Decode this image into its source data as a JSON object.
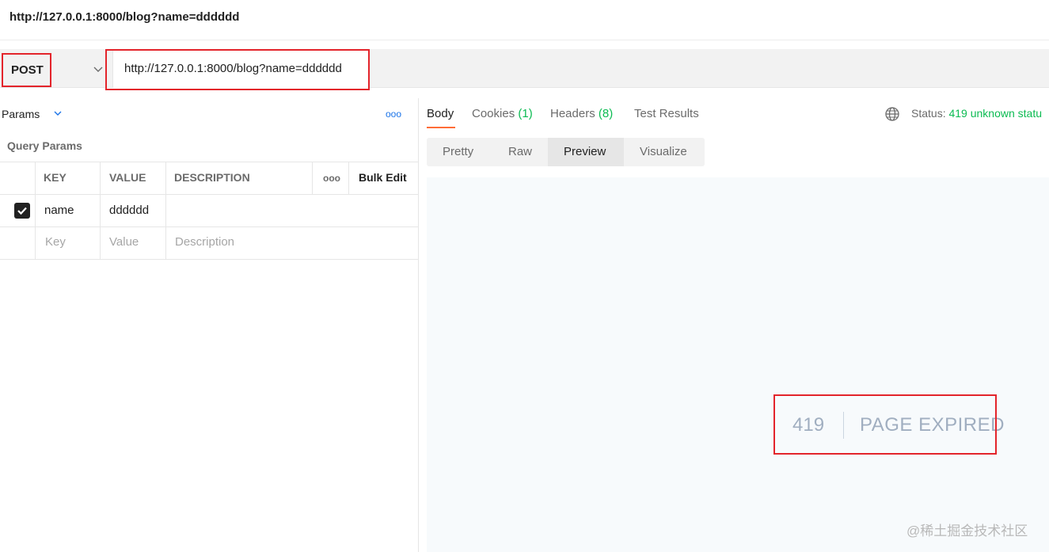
{
  "window": {
    "title": "http://127.0.0.1:8000/blog?name=dddddd"
  },
  "request": {
    "method": "POST",
    "url": "http://127.0.0.1:8000/blog?name=dddddd"
  },
  "params_panel": {
    "tab_label": "Params",
    "section_title": "Query Params",
    "more_icon": "ooo",
    "columns": {
      "key": "KEY",
      "value": "VALUE",
      "description": "DESCRIPTION",
      "bulk_edit": "Bulk Edit",
      "more": "ooo"
    },
    "rows": [
      {
        "checked": true,
        "key": "name",
        "value": "dddddd",
        "description": ""
      }
    ],
    "placeholders": {
      "key": "Key",
      "value": "Value",
      "description": "Description"
    }
  },
  "response": {
    "tabs": {
      "body": "Body",
      "cookies": "Cookies",
      "cookies_count": "(1)",
      "headers": "Headers",
      "headers_count": "(8)",
      "test_results": "Test Results"
    },
    "status_label": "Status:",
    "status_value": "419 unknown statu",
    "view_modes": {
      "pretty": "Pretty",
      "raw": "Raw",
      "preview": "Preview",
      "visualize": "Visualize"
    },
    "active_view": "Preview",
    "preview": {
      "code": "419",
      "message": "PAGE EXPIRED"
    }
  },
  "watermark": "@稀土掘金技术社区",
  "colors": {
    "highlight": "#e3242b",
    "accent": "#ff6c37",
    "count_green": "#0cbb52",
    "link_blue": "#1a73e8"
  }
}
